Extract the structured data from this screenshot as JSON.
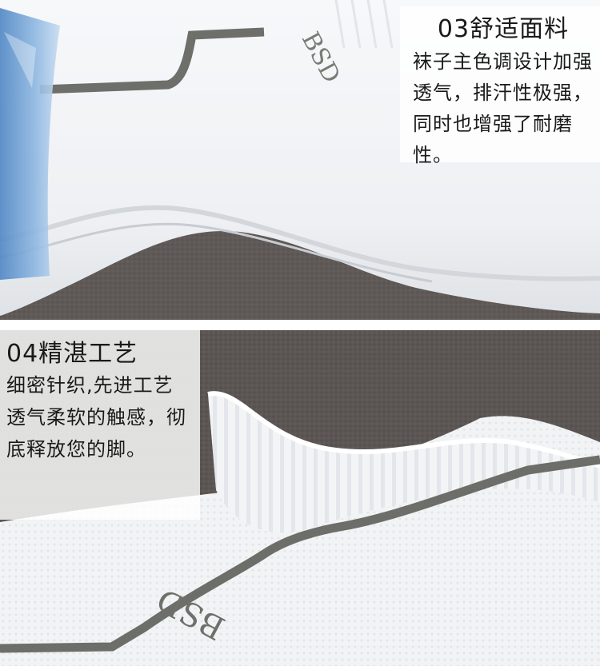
{
  "top_caption": {
    "title": "03舒适面料",
    "body": "袜子主色调设计加强透气，排汗性极强，同时也增强了耐磨性。"
  },
  "bottom_caption": {
    "title": "04精湛工艺",
    "body": "细密针织,先进工艺 透气柔软的触感，彻底释放您的脚。"
  },
  "sock_brand_text": "BSD",
  "colors": {
    "sock_white": "#f4f5f7",
    "sock_stripe": "#6e6e6a",
    "fabric_background": "#5a5552",
    "package_blue": "#6fa0d4"
  }
}
